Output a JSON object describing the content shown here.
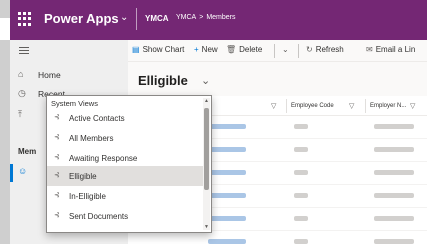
{
  "topbar": {
    "app_title": "Power Apps",
    "org": "YMCA",
    "breadcrumb": [
      "YMCA",
      "Members"
    ]
  },
  "nav": {
    "home": "Home",
    "recent": "Recent",
    "section_label": "Mem"
  },
  "commands": {
    "show_chart": "Show Chart",
    "new": "New",
    "delete": "Delete",
    "refresh": "Refresh",
    "email_link": "Email a Lin"
  },
  "view": {
    "title": "Elligible"
  },
  "grid": {
    "columns": [
      "Employee Code",
      "Employer N..."
    ]
  },
  "dropdown": {
    "header": "System Views",
    "items": [
      {
        "label": "Active Contacts",
        "selected": false
      },
      {
        "label": "All Members",
        "selected": false
      },
      {
        "label": "Awaiting Response",
        "selected": false
      },
      {
        "label": "Elligible",
        "selected": true
      },
      {
        "label": "In-Elligible",
        "selected": false
      },
      {
        "label": "Sent Documents",
        "selected": false
      }
    ]
  },
  "icons": {
    "waffle": "waffle-icon",
    "home": "home-icon",
    "recent": "clock-icon",
    "pinned": "pin-icon",
    "contact": "person-icon",
    "chart": "chart-icon",
    "new": "plus-icon",
    "delete": "trash-icon",
    "refresh": "refresh-icon",
    "email": "email-icon",
    "filter": "filter-icon"
  },
  "colors": {
    "topbar": "#742774",
    "accent": "#0078d4",
    "selected_row": "#e1dfdd"
  }
}
